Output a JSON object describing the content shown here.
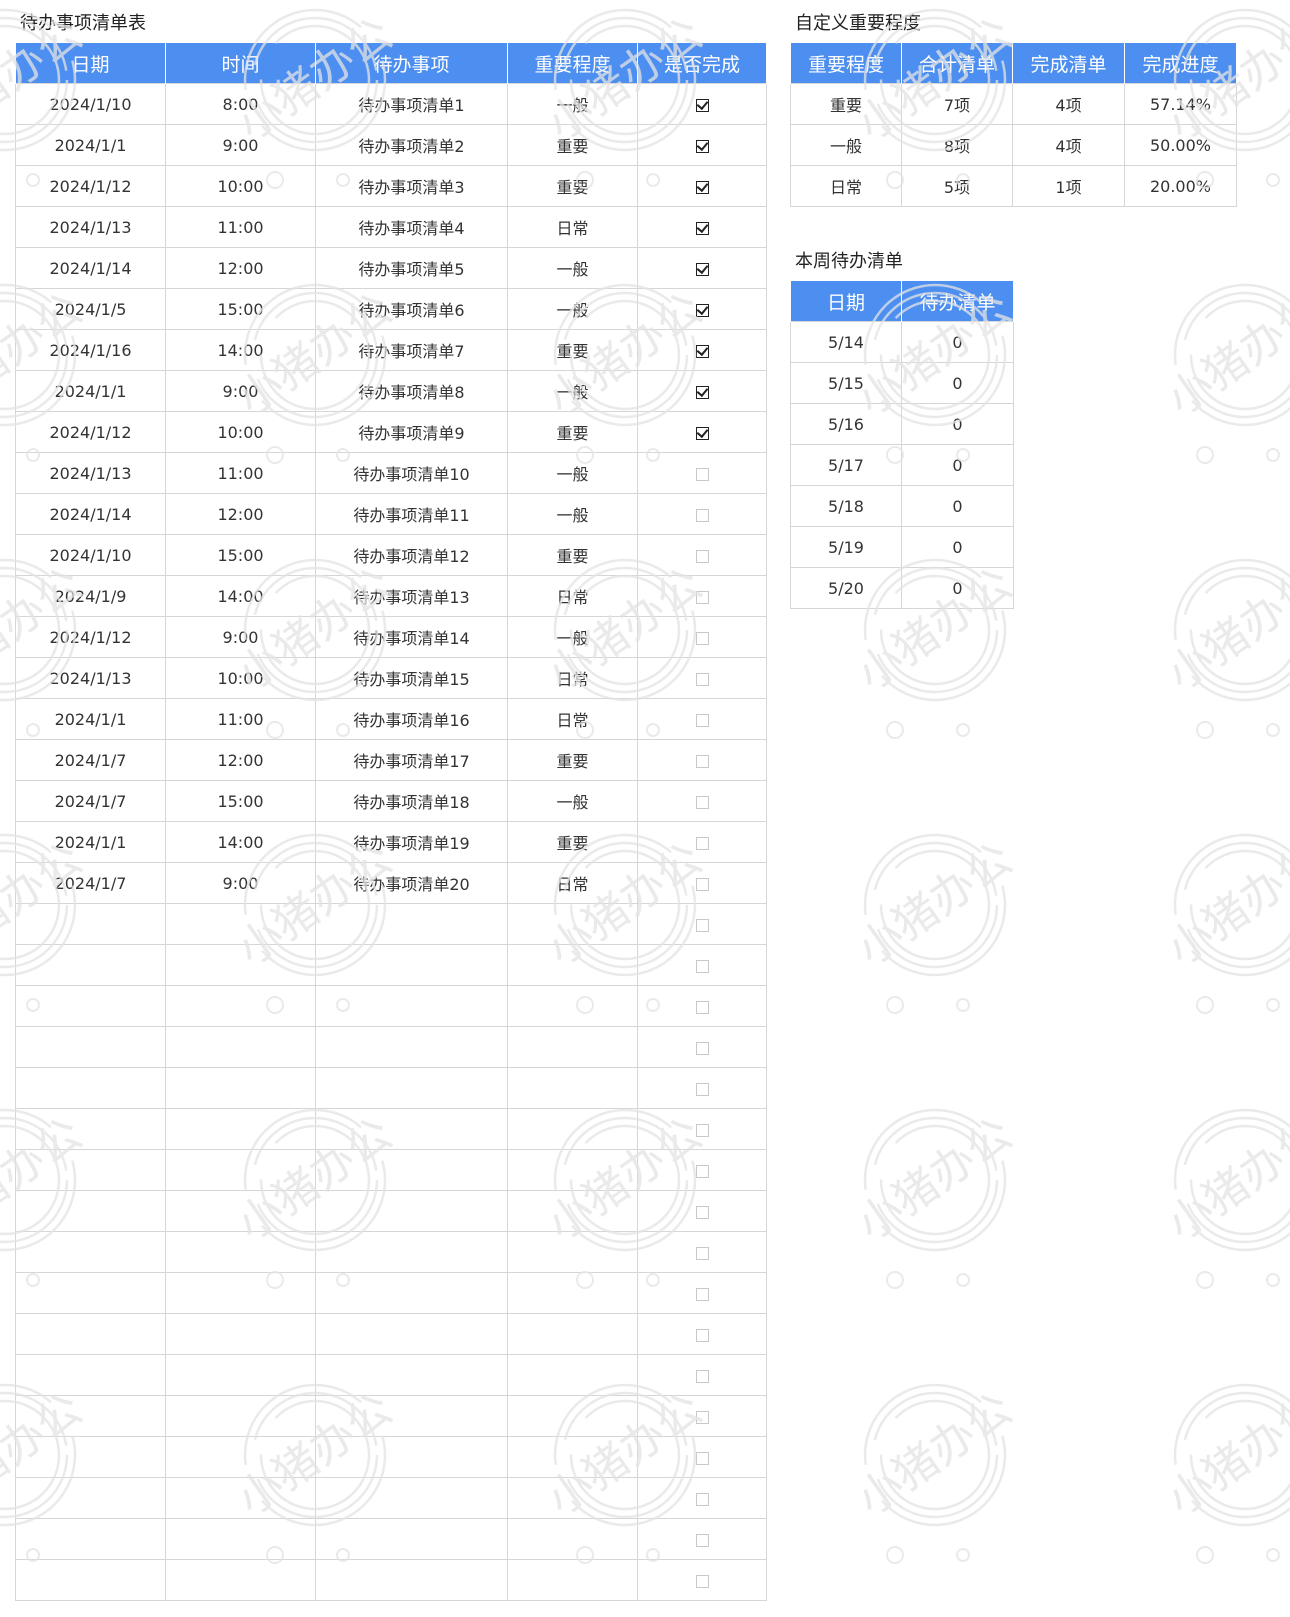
{
  "todo_table": {
    "title": "待办事项清单表",
    "headers": [
      "日期",
      "时间",
      "待办事项",
      "重要程度",
      "是否完成"
    ],
    "rows": [
      {
        "date": "2024/1/10",
        "time": "8:00",
        "item": "待办事项清单1",
        "priority": "一般",
        "done": true
      },
      {
        "date": "2024/1/1",
        "time": "9:00",
        "item": "待办事项清单2",
        "priority": "重要",
        "done": true
      },
      {
        "date": "2024/1/12",
        "time": "10:00",
        "item": "待办事项清单3",
        "priority": "重要",
        "done": true
      },
      {
        "date": "2024/1/13",
        "time": "11:00",
        "item": "待办事项清单4",
        "priority": "日常",
        "done": true
      },
      {
        "date": "2024/1/14",
        "time": "12:00",
        "item": "待办事项清单5",
        "priority": "一般",
        "done": true
      },
      {
        "date": "2024/1/5",
        "time": "15:00",
        "item": "待办事项清单6",
        "priority": "一般",
        "done": true
      },
      {
        "date": "2024/1/16",
        "time": "14:00",
        "item": "待办事项清单7",
        "priority": "重要",
        "done": true
      },
      {
        "date": "2024/1/1",
        "time": "9:00",
        "item": "待办事项清单8",
        "priority": "一般",
        "done": true
      },
      {
        "date": "2024/1/12",
        "time": "10:00",
        "item": "待办事项清单9",
        "priority": "重要",
        "done": true
      },
      {
        "date": "2024/1/13",
        "time": "11:00",
        "item": "待办事项清单10",
        "priority": "一般",
        "done": false
      },
      {
        "date": "2024/1/14",
        "time": "12:00",
        "item": "待办事项清单11",
        "priority": "一般",
        "done": false
      },
      {
        "date": "2024/1/10",
        "time": "15:00",
        "item": "待办事项清单12",
        "priority": "重要",
        "done": false
      },
      {
        "date": "2024/1/9",
        "time": "14:00",
        "item": "待办事项清单13",
        "priority": "日常",
        "done": false
      },
      {
        "date": "2024/1/12",
        "time": "9:00",
        "item": "待办事项清单14",
        "priority": "一般",
        "done": false
      },
      {
        "date": "2024/1/13",
        "time": "10:00",
        "item": "待办事项清单15",
        "priority": "日常",
        "done": false
      },
      {
        "date": "2024/1/1",
        "time": "11:00",
        "item": "待办事项清单16",
        "priority": "日常",
        "done": false
      },
      {
        "date": "2024/1/7",
        "time": "12:00",
        "item": "待办事项清单17",
        "priority": "重要",
        "done": false
      },
      {
        "date": "2024/1/7",
        "time": "15:00",
        "item": "待办事项清单18",
        "priority": "一般",
        "done": false
      },
      {
        "date": "2024/1/1",
        "time": "14:00",
        "item": "待办事项清单19",
        "priority": "重要",
        "done": false
      },
      {
        "date": "2024/1/7",
        "time": "9:00",
        "item": "待办事项清单20",
        "priority": "日常",
        "done": false
      },
      {
        "date": "",
        "time": "",
        "item": "",
        "priority": "",
        "done": false
      },
      {
        "date": "",
        "time": "",
        "item": "",
        "priority": "",
        "done": false
      },
      {
        "date": "",
        "time": "",
        "item": "",
        "priority": "",
        "done": false
      },
      {
        "date": "",
        "time": "",
        "item": "",
        "priority": "",
        "done": false
      },
      {
        "date": "",
        "time": "",
        "item": "",
        "priority": "",
        "done": false
      },
      {
        "date": "",
        "time": "",
        "item": "",
        "priority": "",
        "done": false
      },
      {
        "date": "",
        "time": "",
        "item": "",
        "priority": "",
        "done": false
      },
      {
        "date": "",
        "time": "",
        "item": "",
        "priority": "",
        "done": false
      },
      {
        "date": "",
        "time": "",
        "item": "",
        "priority": "",
        "done": false
      },
      {
        "date": "",
        "time": "",
        "item": "",
        "priority": "",
        "done": false
      },
      {
        "date": "",
        "time": "",
        "item": "",
        "priority": "",
        "done": false
      },
      {
        "date": "",
        "time": "",
        "item": "",
        "priority": "",
        "done": false
      },
      {
        "date": "",
        "time": "",
        "item": "",
        "priority": "",
        "done": false
      },
      {
        "date": "",
        "time": "",
        "item": "",
        "priority": "",
        "done": false
      },
      {
        "date": "",
        "time": "",
        "item": "",
        "priority": "",
        "done": false
      },
      {
        "date": "",
        "time": "",
        "item": "",
        "priority": "",
        "done": false
      },
      {
        "date": "",
        "time": "",
        "item": "",
        "priority": "",
        "done": false
      }
    ]
  },
  "priority_table": {
    "title": "自定义重要程度",
    "headers": [
      "重要程度",
      "合计清单",
      "完成清单",
      "完成进度"
    ],
    "rows": [
      {
        "level": "重要",
        "total": "7项",
        "done": "4项",
        "progress": "57.14%"
      },
      {
        "level": "一般",
        "total": "8项",
        "done": "4项",
        "progress": "50.00%"
      },
      {
        "level": "日常",
        "total": "5项",
        "done": "1项",
        "progress": "20.00%"
      }
    ]
  },
  "week_table": {
    "title": "本周待办清单",
    "headers": [
      "日期",
      "待办清单"
    ],
    "rows": [
      {
        "date": "5/14",
        "count": "0"
      },
      {
        "date": "5/15",
        "count": "0"
      },
      {
        "date": "5/16",
        "count": "0"
      },
      {
        "date": "5/17",
        "count": "0"
      },
      {
        "date": "5/18",
        "count": "0"
      },
      {
        "date": "5/19",
        "count": "0"
      },
      {
        "date": "5/20",
        "count": "0"
      }
    ]
  },
  "watermark": {
    "text": "小猪办公",
    "color": "#e3e3e3"
  },
  "colors": {
    "header_bg": "#4d8ff0",
    "header_text": "#ffffff",
    "grid_line": "#d6d6d6"
  }
}
